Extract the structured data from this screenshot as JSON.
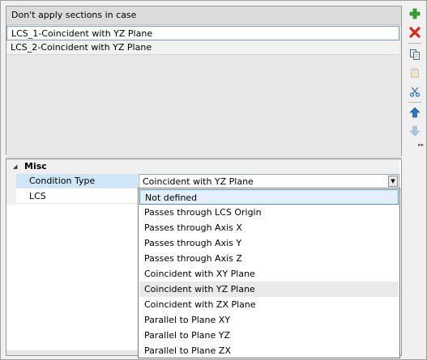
{
  "list": {
    "header": "Don't apply sections in case",
    "rows": [
      "LCS_1-Coincident with YZ Plane",
      "LCS_2-Coincident with YZ Plane"
    ]
  },
  "toolbar": {
    "icons": [
      "add-icon",
      "delete-icon",
      "copy-icon",
      "paste-icon",
      "cut-icon",
      "move-up-icon",
      "move-down-icon",
      "more-icon"
    ],
    "colors": {
      "add": "#2ea82e",
      "delete": "#d42a1e",
      "move": "#2a74c8"
    }
  },
  "properties": {
    "category": "Misc",
    "condition_type_label": "Condition Type",
    "condition_type_value": "Coincident with YZ Plane",
    "lcs_label": "LCS"
  },
  "dropdown": {
    "options": [
      "Not defined",
      "Passes through LCS Origin",
      "Passes through Axis X",
      "Passes through Axis Y",
      "Passes through Axis Z",
      "Coincident with XY Plane",
      "Coincident with YZ Plane",
      "Coincident with ZX Plane",
      "Parallel to Plane XY",
      "Parallel to Plane YZ",
      "Parallel to Plane ZX"
    ],
    "focused": "Not defined",
    "current": "Coincident with YZ Plane"
  }
}
